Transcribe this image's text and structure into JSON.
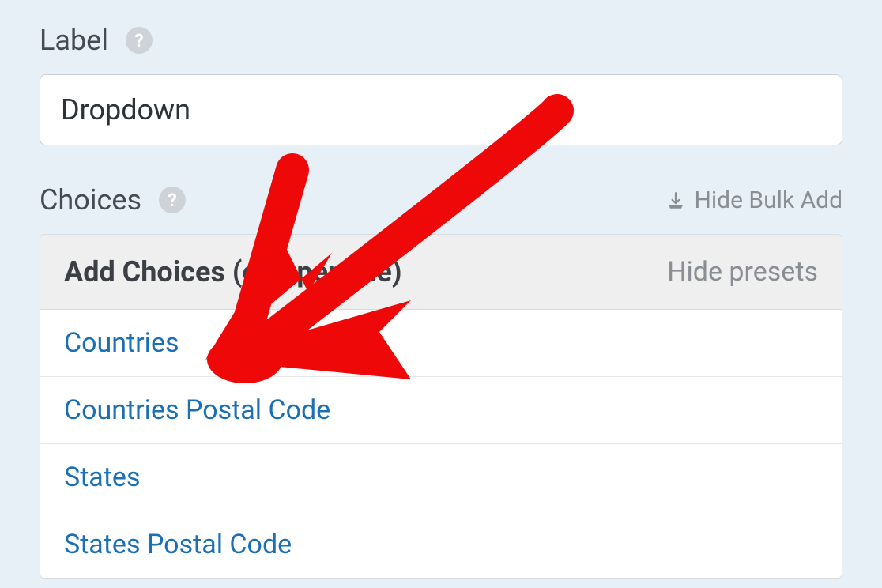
{
  "label_section": {
    "title": "Label",
    "value": "Dropdown"
  },
  "choices_section": {
    "title": "Choices",
    "bulk_link": "Hide Bulk Add"
  },
  "panel": {
    "title": "Add Choices (one per line)",
    "action": "Hide presets",
    "presets": [
      "Countries",
      "Countries Postal Code",
      "States",
      "States Postal Code"
    ]
  }
}
